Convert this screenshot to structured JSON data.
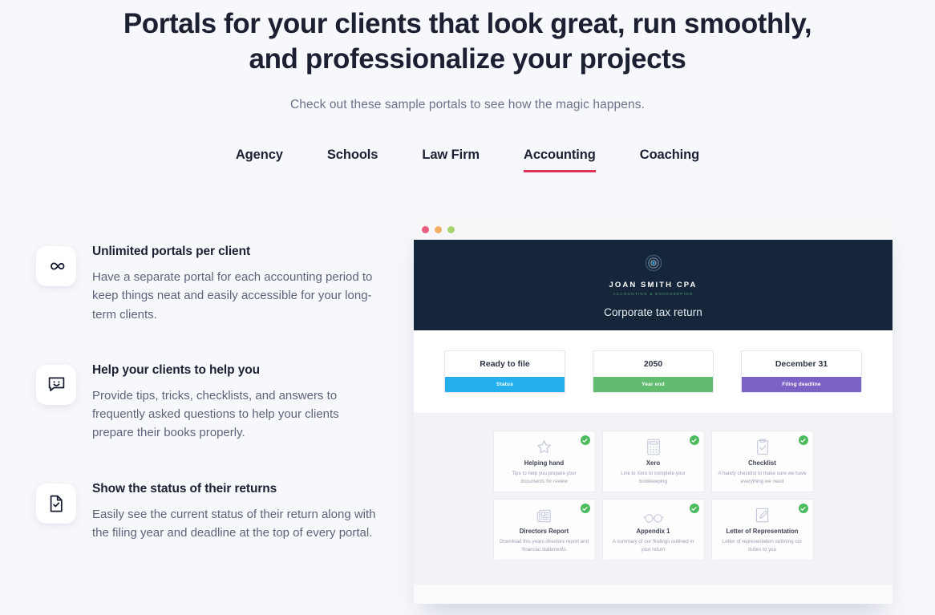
{
  "header": {
    "headline": "Portals for your clients that look great, run smoothly, and professionalize your projects",
    "subhead": "Check out these sample portals to see how the magic happens.",
    "accent_color": "#e0315b"
  },
  "tabs": [
    {
      "label": "Agency",
      "active": false
    },
    {
      "label": "Schools",
      "active": false
    },
    {
      "label": "Law Firm",
      "active": false
    },
    {
      "label": "Accounting",
      "active": true
    },
    {
      "label": "Coaching",
      "active": false
    }
  ],
  "features": [
    {
      "icon": "infinity-icon",
      "title": "Unlimited portals per client",
      "text": "Have a separate portal for each accounting period to keep things neat and easily accessible for your long-term clients."
    },
    {
      "icon": "chat-smiley-icon",
      "title": "Help your clients to help you",
      "text": "Provide tips, tricks, checklists, and answers to frequently asked questions to help your clients prepare their books properly."
    },
    {
      "icon": "document-check-icon",
      "title": "Show the status of their returns",
      "text": "Easily see the current status of their return along with the filing year and deadline at the top of every portal."
    }
  ],
  "mockup": {
    "window_dots": [
      "#ea5d7c",
      "#f0b165",
      "#a9d56e"
    ],
    "hero": {
      "logo_icon": "target-circles-icon",
      "logo_name": "JOAN SMITH CPA",
      "logo_tagline": "ACCOUNTING & BOOKKEEPING",
      "title": "Corporate tax return",
      "background_color": "#16263a"
    },
    "status_cards": [
      {
        "value": "Ready to file",
        "label": "Status",
        "color": "#24b0ed"
      },
      {
        "value": "2050",
        "label": "Year end",
        "color": "#62bc6f"
      },
      {
        "value": "December 31",
        "label": "Filing deadline",
        "color": "#7a63c4"
      }
    ],
    "documents": [
      {
        "icon": "star-icon",
        "title": "Helping hand",
        "desc": "Tips to help you prepare your documents for review",
        "checked": true
      },
      {
        "icon": "calculator-icon",
        "title": "Xero",
        "desc": "Link to Xero to complete your bookkeeping",
        "checked": true
      },
      {
        "icon": "clipboard-check-icon",
        "title": "Checklist",
        "desc": "A handy checklist to make sure we have everything we need",
        "checked": true
      },
      {
        "icon": "newspaper-icon",
        "title": "Directors Report",
        "desc": "Download this years directors report and financial statements",
        "checked": true
      },
      {
        "icon": "glasses-icon",
        "title": "Appendix 1",
        "desc": "A summary of our findings outlined in your return",
        "checked": true
      },
      {
        "icon": "pencil-document-icon",
        "title": "Letter of Representation",
        "desc": "Letter of representation outlining our duties to you",
        "checked": true
      }
    ]
  }
}
